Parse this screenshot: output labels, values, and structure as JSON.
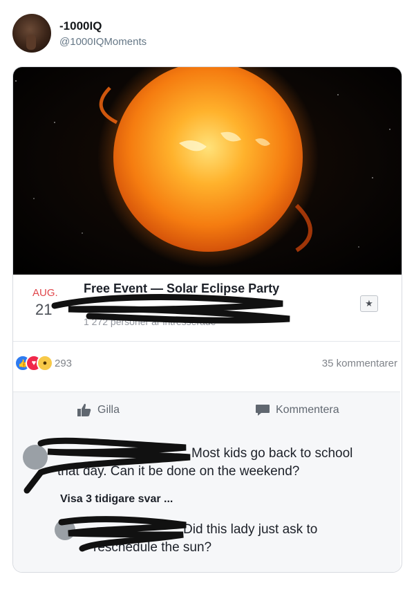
{
  "tweet": {
    "display_name": "-1000IQ",
    "handle": "@1000IQMoments"
  },
  "event": {
    "month": "AUG.",
    "day": "21",
    "title": "Free Event — Solar Eclipse Party",
    "interested": "1 272 personer är intresserade",
    "save_icon": "★"
  },
  "reactions": {
    "count": "293",
    "comments": "35 kommentarer",
    "icons": [
      "like-icon",
      "love-icon",
      "wow-icon"
    ]
  },
  "actions": {
    "like_label": "Gilla",
    "comment_label": "Kommentera"
  },
  "comments": {
    "first_text_line1": "Most kids go back to school",
    "first_text_line2": "that day. Can it be done on the weekend?",
    "view_replies": "Visa 3 tidigare svar ...",
    "reply_text_line1": "Did this lady just ask to",
    "reply_text_line2": "reschedule the sun?"
  },
  "colors": {
    "accent_red": "#e0464b",
    "like_blue": "#2e7bf0",
    "love_red": "#f0284a",
    "wow_yellow": "#f7c948"
  }
}
